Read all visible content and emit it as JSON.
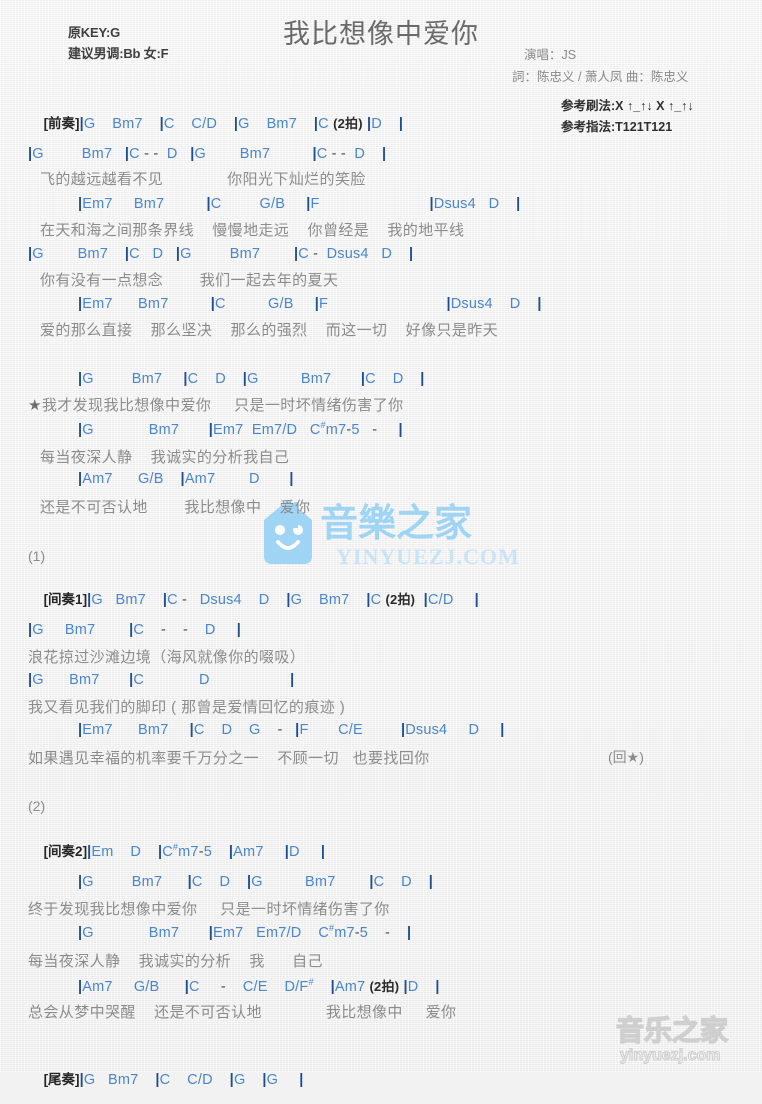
{
  "header": {
    "original_key": "原KEY:G",
    "suggested_key": "建议男调:Bb 女:F",
    "title": "我比想像中爱你",
    "singer": "演唱：JS",
    "credits": "詞：陈忠义 / 萧人凤   曲：陈忠义",
    "strum_label": "参考刷法:",
    "strum_pattern": "X ↑_↑↓ X ↑_↑↓",
    "finger_label": "参考指法:",
    "finger_pattern": "T121T121"
  },
  "watermark": {
    "center_cn": "音樂之家",
    "center_url": "YINYUEZJ.COM",
    "bottom_cn": "音乐之家",
    "bottom_url": "yinyuezj.com",
    "center_color": "#9bd3f5",
    "bottom_color": "#c9c9c9"
  },
  "colors": {
    "chord": "#4a86c8",
    "barline": "#1f4d8f",
    "lyric": "#8c8c8c",
    "tag": "#262626",
    "title": "#6a6a6a"
  },
  "sections": {
    "intro_tag": "[前奏]",
    "interlude1_tag": "[间奏1]",
    "interlude2_tag": "[间奏2]",
    "outro_tag": "[尾奏]",
    "verse1_number": "(1)",
    "verse2_number": "(2)",
    "repeat_note": "(回★)"
  },
  "lines": [
    {
      "id": "intro",
      "type": "chord",
      "text": "|G    Bm7    |C    C/D    |G    Bm7    |C (2拍) |D    |"
    },
    {
      "id": "c1",
      "type": "chord",
      "text": "|G         Bm7   |C - -  D   |G        Bm7          |C - -  D    |"
    },
    {
      "id": "l1",
      "type": "lyric",
      "text": "飞的越远越看不见              你阳光下灿烂的笑脸"
    },
    {
      "id": "c2",
      "type": "chord",
      "text": "|Em7     Bm7          |C         G/B     |F                          |Dsus4   D    |"
    },
    {
      "id": "l2",
      "type": "lyric",
      "text": "在天和海之间那条界线    慢慢地走远    你曾经是    我的地平线"
    },
    {
      "id": "c3",
      "type": "chord",
      "text": "|G        Bm7    |C   D   |G         Bm7        |C -  Dsus4   D    |"
    },
    {
      "id": "l3",
      "type": "lyric",
      "text": "你有没有一点想念        我们一起去年的夏天"
    },
    {
      "id": "c4",
      "type": "chord",
      "text": "|Em7      Bm7          |C          G/B     |F                            |Dsus4    D    |"
    },
    {
      "id": "l4",
      "type": "lyric",
      "text": "爱的那么直接    那么坚决    那么的强烈    而这一切    好像只是昨天"
    },
    {
      "id": "c5",
      "type": "chord",
      "text": "|G         Bm7     |C    D    |G          Bm7       |C    D    |"
    },
    {
      "id": "l5",
      "type": "lyric",
      "text": "★我才发现我比想像中爱你     只是一时坏情绪伤害了你"
    },
    {
      "id": "c6",
      "type": "chord",
      "text": "|G             Bm7       |Em7  Em7/D   C#m7-5   -     |"
    },
    {
      "id": "l6",
      "type": "lyric",
      "text": "每当夜深人静    我诚实的分析我自己"
    },
    {
      "id": "c7",
      "type": "chord",
      "text": "|Am7      G/B    |Am7        D       |"
    },
    {
      "id": "l7",
      "type": "lyric",
      "text": "还是不可否认地        我比想像中    爱你"
    },
    {
      "id": "inter1",
      "type": "chord",
      "text": "|G   Bm7    |C -   Dsus4    D    |G    Bm7    |C (2拍)  |C/D     |"
    },
    {
      "id": "c8",
      "type": "chord",
      "text": "|G     Bm7        |C    -    -    D     |"
    },
    {
      "id": "l8",
      "type": "lyric",
      "text": "浪花掠过沙滩边境（海风就像你的啜吸）"
    },
    {
      "id": "c9",
      "type": "chord",
      "text": "|G      Bm7       |C             D                   |"
    },
    {
      "id": "l9",
      "type": "lyric",
      "text": "我又看见我们的脚印 ( 那曾是爱情回忆的痕迹 )"
    },
    {
      "id": "c10",
      "type": "chord",
      "text": "|Em7      Bm7     |C    D    G    -   |F       C/E         |Dsus4     D     |"
    },
    {
      "id": "l10",
      "type": "lyric",
      "text": "如果遇见幸福的机率要千万分之一    不顾一切   也要找回你"
    },
    {
      "id": "inter2",
      "type": "chord",
      "text": "|Em    D    |C#m7-5    |Am7     |D     |"
    },
    {
      "id": "c11",
      "type": "chord",
      "text": "|G         Bm7      |C    D    |G          Bm7        |C    D    |"
    },
    {
      "id": "l11",
      "type": "lyric",
      "text": "终于发现我比想像中爱你     只是一时坏情绪伤害了你"
    },
    {
      "id": "c12",
      "type": "chord",
      "text": "|G             Bm7       |Em7   Em7/D    C#m7-5    -    |"
    },
    {
      "id": "l12",
      "type": "lyric",
      "text": "每当夜深人静    我诚实的分析    我      自己"
    },
    {
      "id": "c13",
      "type": "chord",
      "text": "|Am7     G/B      |C     -    C/E    D/F#    |Am7 (2拍) |D    |"
    },
    {
      "id": "l13",
      "type": "lyric",
      "text": "总会从梦中哭醒    还是不可否认地              我比想像中     爱你"
    },
    {
      "id": "outro",
      "type": "chord",
      "text": "|G   Bm7    |C    C/D    |G    |G     |"
    }
  ]
}
